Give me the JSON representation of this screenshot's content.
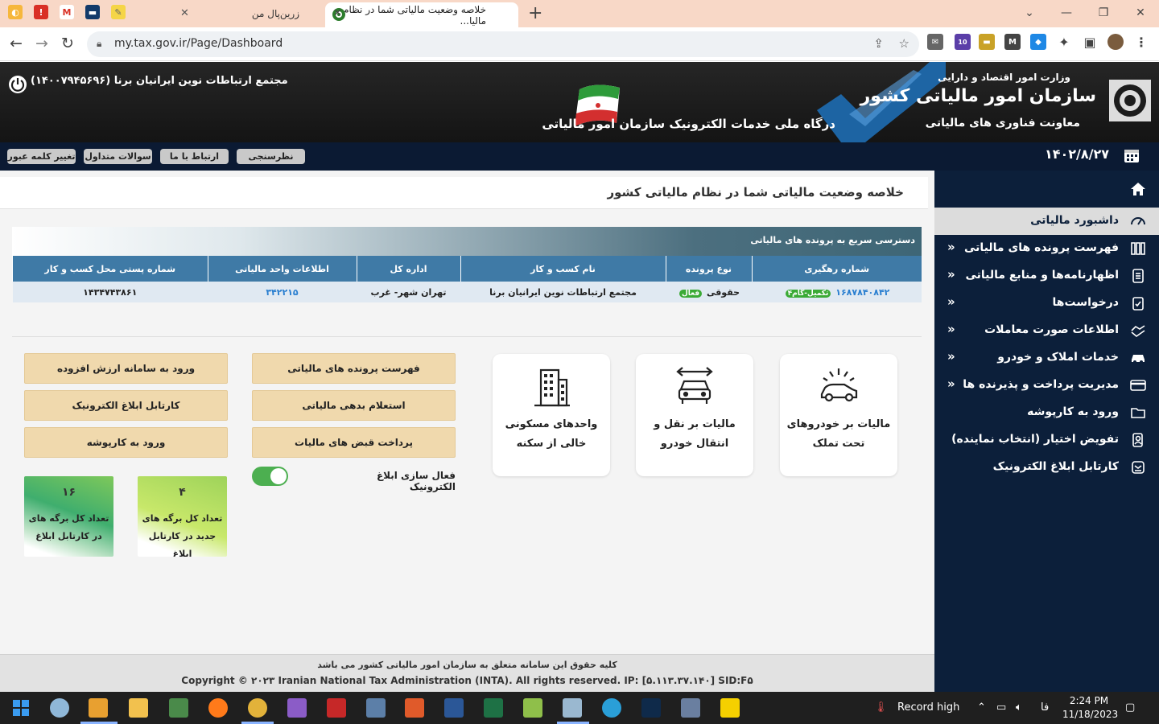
{
  "browser": {
    "tabs": [
      {
        "title": "زرین‌پال من"
      },
      {
        "title": "خلاصه وضعیت مالیاتی شما در نظام مالیا..."
      }
    ],
    "url": "my.tax.gov.ir/Page/Dashboard",
    "extension_badge": "10"
  },
  "header": {
    "ministry": "وزارت امور اقتصاد و دارایی",
    "org_name": "سازمان امور مالیاتی کشور",
    "deputy": "معاونت فناوری های مالیاتی",
    "portal": "درگاه ملی خدمات الکترونیک سازمان امور مالیاتی",
    "company": "مجتمع ارتباطات نوین ایرانیان برنا (۱۴۰۰۷۹۴۵۶۹۶)"
  },
  "topnav": {
    "buttons": [
      "نظرسنجی",
      "ارتباط با ما",
      "سوالات متداول",
      "تغییر کلمه عبور"
    ],
    "date": "۱۴۰۲/۸/۲۷"
  },
  "sidebar": {
    "items": [
      {
        "label": "داشبورد مالیاتی",
        "icon": "dashboard-icon",
        "active": true
      },
      {
        "label": "فهرست پرونده های مالیاتی",
        "icon": "files-icon"
      },
      {
        "label": "اظهارنامه‌ها و منابع مالیاتی",
        "icon": "document-icon"
      },
      {
        "label": "درخواست‌ها",
        "icon": "request-icon"
      },
      {
        "label": "اطلاعات صورت معاملات",
        "icon": "transactions-icon"
      },
      {
        "label": "خدمات املاک و خودرو",
        "icon": "car-icon"
      },
      {
        "label": "مدیریت پرداخت و پذیرنده ها",
        "icon": "card-icon"
      },
      {
        "label": "ورود به کارپوشه",
        "icon": "folder-icon"
      },
      {
        "label": "تفویض اختیار (انتخاب نماینده)",
        "icon": "delegate-icon"
      },
      {
        "label": "کارتابل ابلاغ الکترونیک",
        "icon": "notice-icon"
      }
    ]
  },
  "main": {
    "title": "خلاصه وضعیت مالیاتی شما در نظام مالیاتی کشور",
    "quick_title": "دسترسی سریع به پرونده های مالیاتی",
    "table": {
      "headers": [
        "شماره رهگیری",
        "نوع پرونده",
        "نام کسب و کار",
        "اداره کل",
        "اطلاعات واحد مالیاتی",
        "شماره پستی محل کسب و کار"
      ],
      "row": {
        "tracking": "۱۶۸۷۸۴۰۸۴۲",
        "tracking_badge": "تکمیل-گام۴",
        "type": "حقوقی",
        "type_badge": "فعال",
        "business": "مجتمع ارتباطات نوین ایرانیان برنا",
        "office": "تهران شهر- غرب",
        "unit": "۳۴۲۲۱۵",
        "postal": "۱۴۳۴۷۴۳۸۶۱"
      }
    },
    "cards": [
      {
        "label": "مالیات بر خودروهای تحت تملک",
        "icon": "car-tax-icon"
      },
      {
        "label": "مالیات بر نقل و انتقال خودرو",
        "icon": "car-transfer-icon"
      },
      {
        "label": "واحدهای مسکونی خالی از سکنه",
        "icon": "building-icon"
      }
    ],
    "actions": [
      "فهرست پرونده های مالیاتی",
      "استعلام بدهی مالیاتی",
      "پرداخت قبض های مالیات",
      "ورود به سامانه ارزش افزوده",
      "کارتابل ابلاغ الکترونیک",
      "ورود به کارپوشه"
    ],
    "toggle_label": "فعال سازی ابلاغ الکترونیک",
    "toggle_on": true,
    "stats": [
      {
        "value": "۴",
        "label": "تعداد کل برگه های جدید در کارتابل ابلاغ"
      },
      {
        "value": "۱۶",
        "label": "تعداد کل برگه های در کارتابل ابلاغ"
      }
    ]
  },
  "footer": {
    "rights": "کلیه حقوق این سامانه متعلق به سازمان امور مالیاتی کشور می باشد",
    "copyright": "Copyright © ۲۰۲۳ Iranian National Tax Administration (INTA). All rights reserved. IP: [۵.۱۱۳.۳۷.۱۴۰] SID:F۵"
  },
  "taskbar": {
    "weather": "Record high",
    "lang": "فا",
    "time": "2:24 PM",
    "date": "11/18/2023"
  },
  "colors": {
    "header_bg": "#1c1c1c",
    "sidebar_bg": "#0c1f3a",
    "table_header": "#3f7aa6",
    "action_button": "#f0d9ad",
    "toggle_on": "#4caf50"
  }
}
